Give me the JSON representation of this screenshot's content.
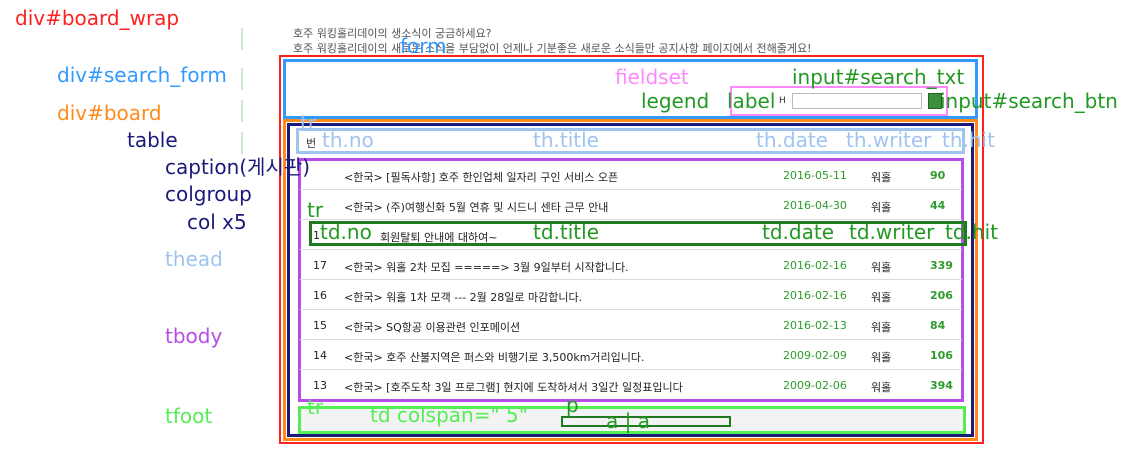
{
  "colors": {
    "board_wrap": "#ff2020",
    "search_form": "#3399ff",
    "board": "#ff8c1a",
    "table": "#1a1a7a",
    "fieldset": "#ff88ff",
    "input": "#229922",
    "caption": "#1a1a7a",
    "thead": "#a0c4f0",
    "tbody": "#b74ce6",
    "tfoot": "#55ee55"
  },
  "labels": {
    "board_wrap": "div#board_wrap",
    "search_form": "div#search_form",
    "board": "div#board",
    "table": "table",
    "caption": "caption(게시판)",
    "colgroup": "colgroup",
    "col": "col x5",
    "thead": "thead",
    "tbody": "tbody",
    "tfoot": "tfoot",
    "form": "form",
    "fieldset": "fieldset",
    "search_txt": "input#search_txt",
    "legend": "legend",
    "label": "label",
    "search_btn": "input#search_btn",
    "tr_head": "tr",
    "th_no": "th.no",
    "th_title": "th.title",
    "th_date": "th.date",
    "th_writer": "th.writer",
    "th_hit": "th.hit",
    "tr_body": "tr",
    "td_no": "td.no",
    "td_title": "td.title",
    "td_date": "td.date",
    "td_writer": "td.writer",
    "td_hit": "td.hit",
    "tr_foot": "tr",
    "td_colspan": "td colspan=\" 5\"",
    "p": "p",
    "a_a": "a | a"
  },
  "intro": {
    "line1": "호주 워킹홀리데이의 생소식이 궁금하세요?",
    "line2": "호주 워킹홀리데이의 새로운 소식을 부담없이 언제나 기분좋은 새로운 소식들만 공지사항 페이지에서 전해줄게요!"
  },
  "search": {
    "label_text": "H"
  },
  "thead_first": "번",
  "rows": [
    {
      "no": "",
      "title": "<한국> [필독사항] 호주 한인업체 일자리 구인 서비스 오픈",
      "date": "2016-05-11",
      "writer": "워홀",
      "hit": "90"
    },
    {
      "no": "",
      "title": "<한국> (주)여행신화 5월 연휴 및 시드니 센타 근무 안내",
      "date": "2016-04-30",
      "writer": "워홀",
      "hit": "44"
    },
    {
      "no": "1",
      "title": "회원탈퇴 안내에 대하여~",
      "date": "",
      "writer": "",
      "hit": ""
    },
    {
      "no": "17",
      "title": "<한국> 워홀 2차 모집 =====> 3월 9일부터 시작합니다.",
      "date": "2016-02-16",
      "writer": "워홀",
      "hit": "339"
    },
    {
      "no": "16",
      "title": "<한국> 워홀 1차 모객 --- 2월 28일로 마감합니다.",
      "date": "2016-02-16",
      "writer": "워홀",
      "hit": "206"
    },
    {
      "no": "15",
      "title": "<한국> SQ항공 이용관련 인포메이션",
      "date": "2016-02-13",
      "writer": "워홀",
      "hit": "84"
    },
    {
      "no": "14",
      "title": "<한국> 호주 산불지역은 퍼스와 비행기로 3,500km거리입니다.",
      "date": "2009-02-09",
      "writer": "워홀",
      "hit": "106"
    },
    {
      "no": "13",
      "title": "<한국> [호주도착 3일 프로그램] 현지에 도착하셔서 3일간 일정표입니다",
      "date": "2009-02-06",
      "writer": "워홀",
      "hit": "394"
    }
  ]
}
